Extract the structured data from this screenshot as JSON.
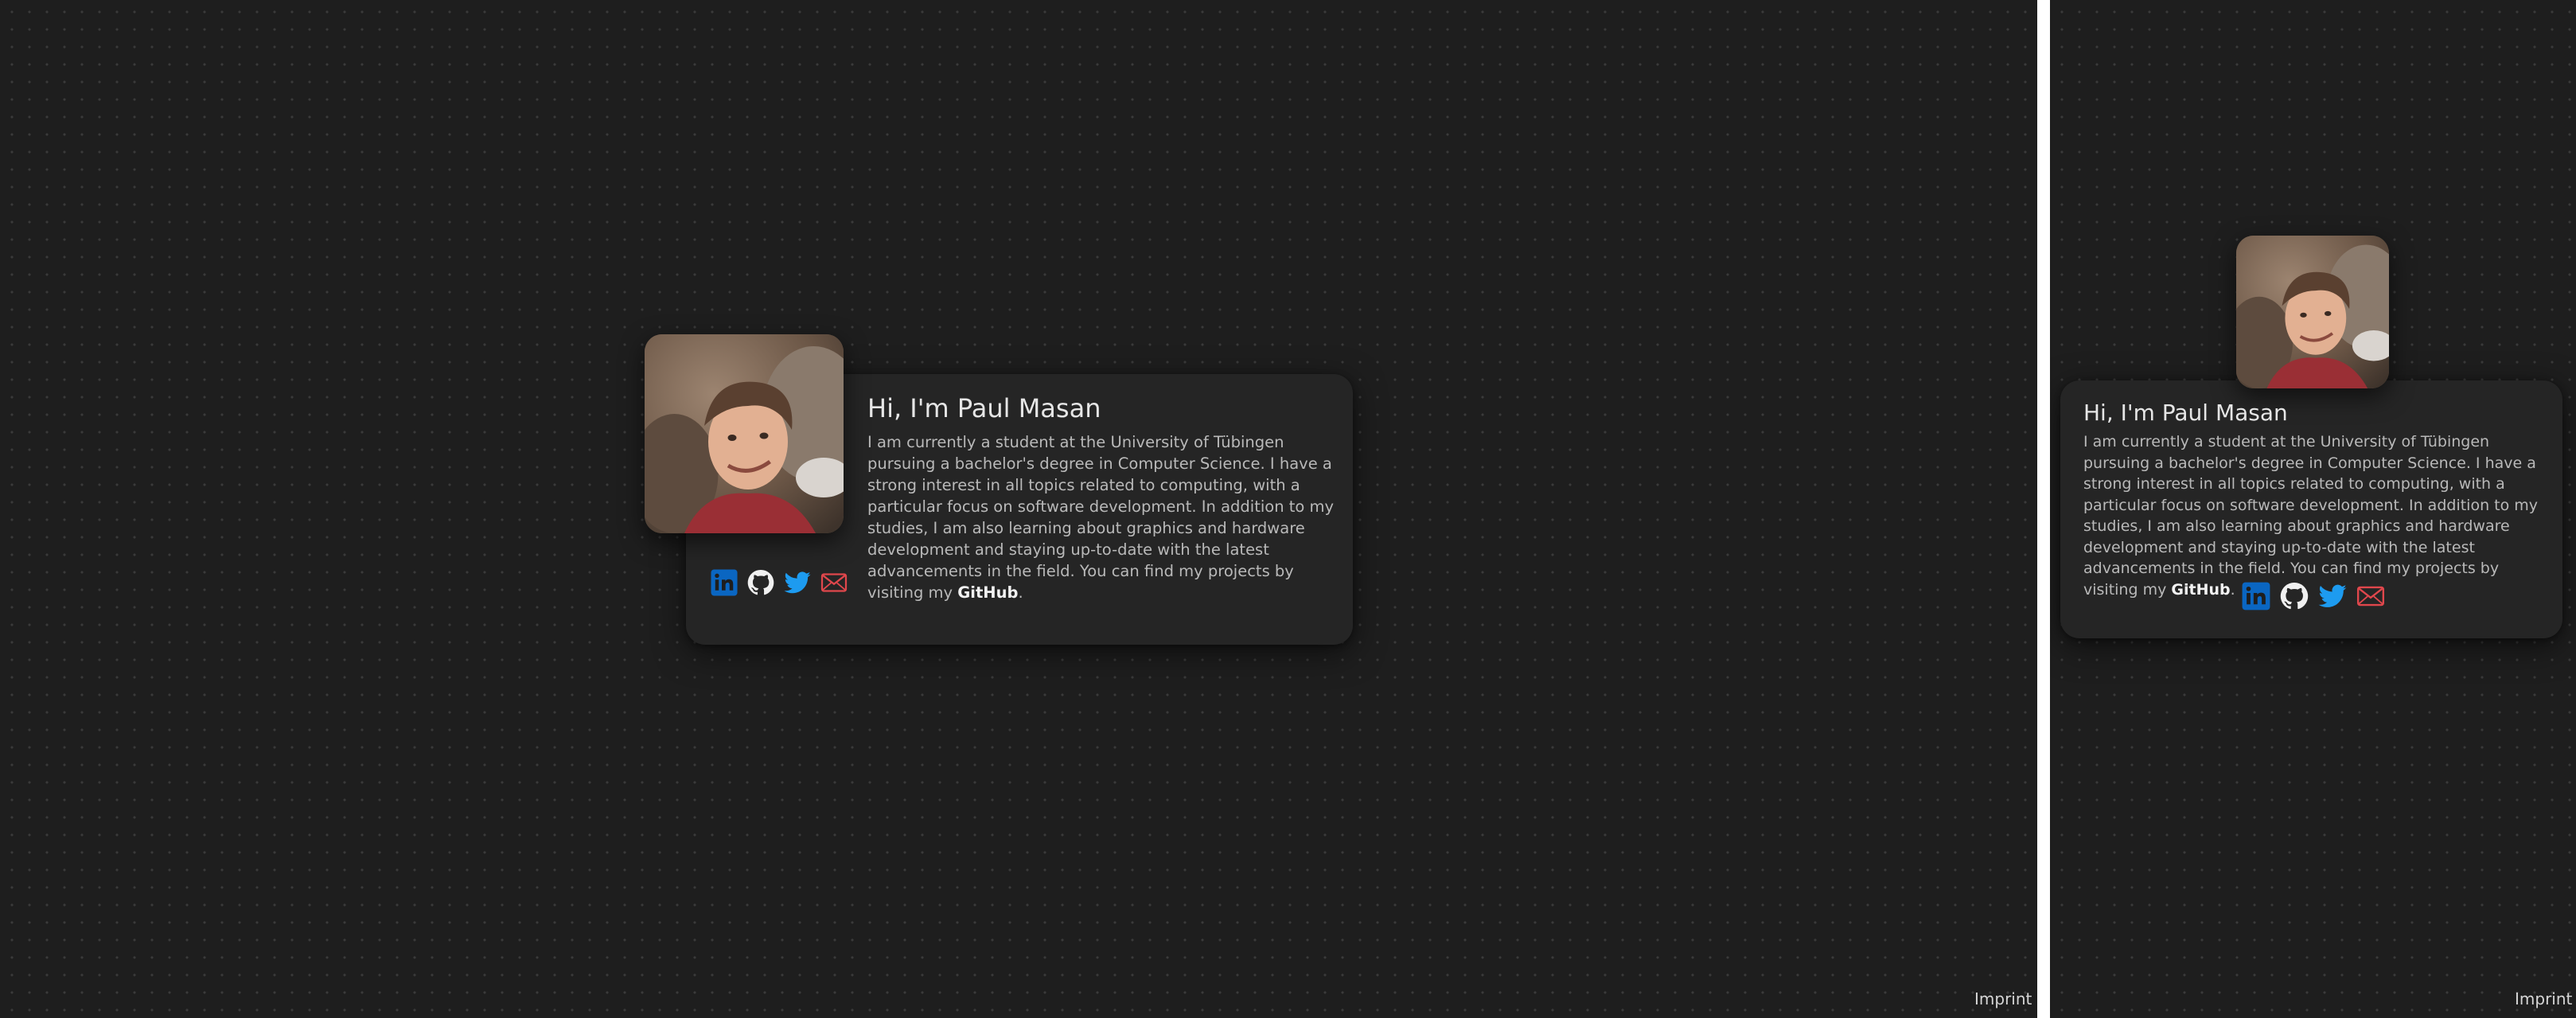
{
  "profile": {
    "heading": "Hi, I'm Paul Masan",
    "bio_text": "I am currently a student at the University of Tübingen pursuing a bachelor's degree in Computer Science. I have a strong interest in all topics related to computing, with a particular focus on software development. In addition to my studies, I am also learning about graphics and hardware development and staying up-to-date with the latest advancements in the field. You can find my projects by visiting my",
    "bio_link": "GitHub",
    "bio_end": "."
  },
  "socials": [
    {
      "icon": "linkedin-icon",
      "color": "#0a66c2"
    },
    {
      "icon": "github-icon",
      "color": "#f0f0f0"
    },
    {
      "icon": "twitter-icon",
      "color": "#1d9bf0"
    },
    {
      "icon": "mail-icon",
      "color": "#e0474c"
    }
  ],
  "footer": {
    "imprint_label": "Imprint"
  },
  "theme": {
    "background": "#1e1e1e",
    "card": "#252525",
    "text": "#b9b9b9"
  }
}
